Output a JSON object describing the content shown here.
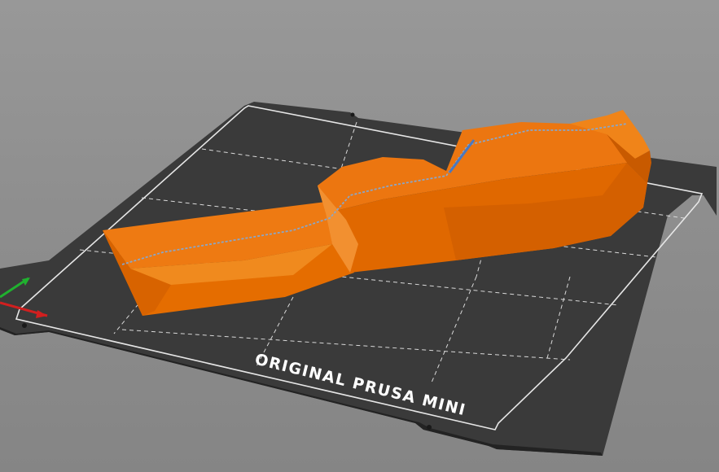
{
  "viewport": {
    "printer_bed": {
      "label": "ORIGINAL PRUSA MINI",
      "color": "#3a3a3a",
      "grid_color": "#d9d9d9"
    },
    "model": {
      "color": "#e56d00",
      "shade_color": "#c45700",
      "highlight_color": "#f08a1e",
      "seam_color": "#8aa6c8"
    },
    "axes": {
      "x_color": "#d11f1f",
      "y_color": "#20b12f"
    }
  }
}
